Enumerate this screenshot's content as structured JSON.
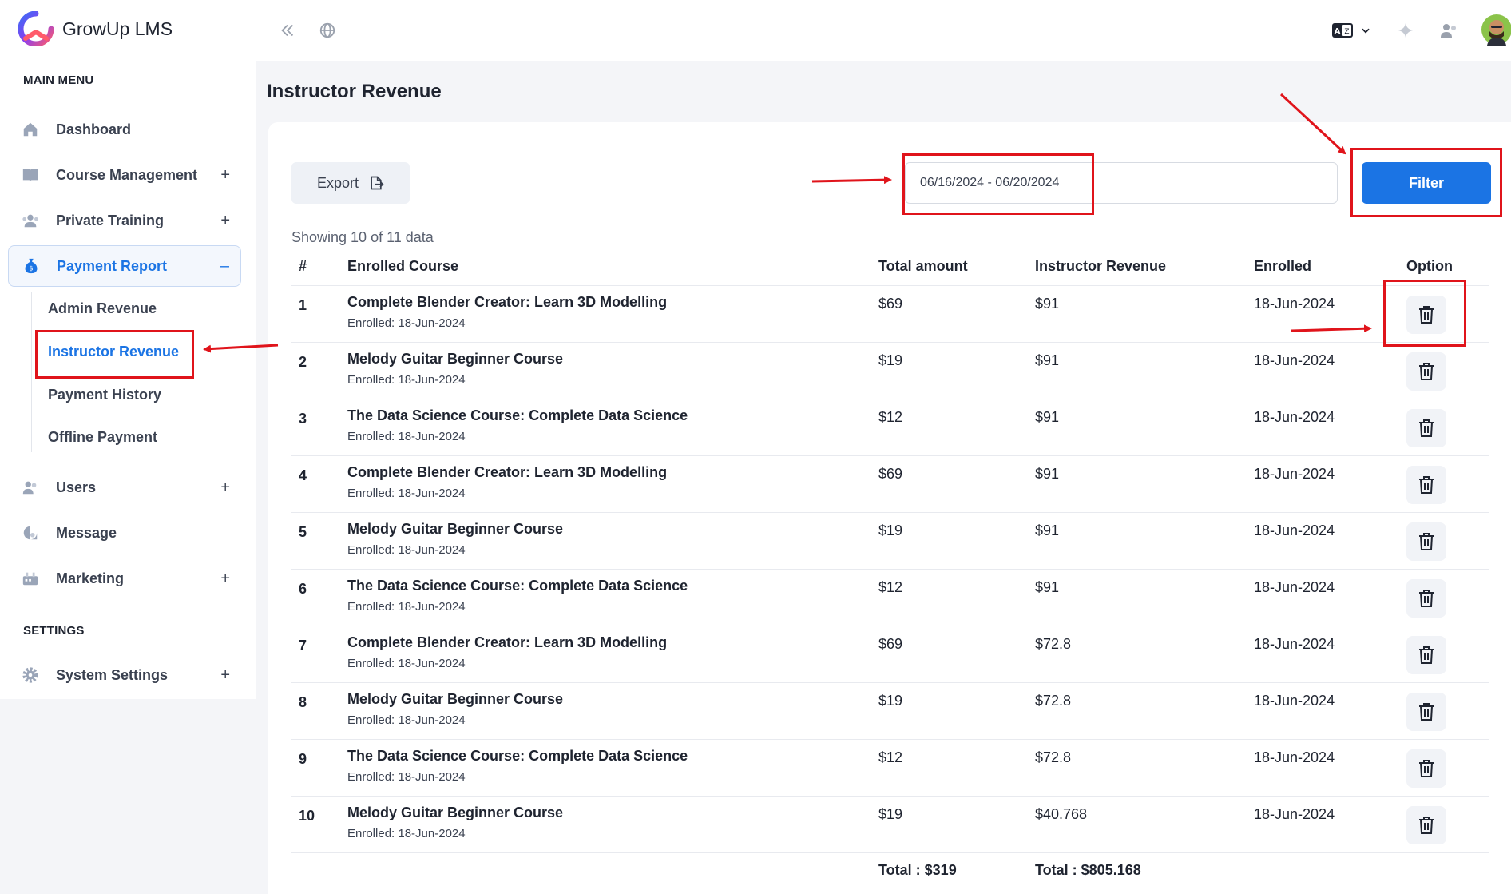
{
  "app": {
    "name": "GrowUp LMS"
  },
  "sidebar": {
    "main_menu_label": "MAIN MENU",
    "settings_label": "SETTINGS",
    "items": [
      {
        "label": "Dashboard",
        "icon": "home-icon"
      },
      {
        "label": "Course Management",
        "icon": "book-icon",
        "toggle": "+"
      },
      {
        "label": "Private Training",
        "icon": "users-icon",
        "toggle": "+"
      },
      {
        "label": "Payment Report",
        "icon": "money-bag-icon",
        "toggle": "–"
      },
      {
        "label": "Users",
        "icon": "user-icon",
        "toggle": "+"
      },
      {
        "label": "Message",
        "icon": "message-icon"
      },
      {
        "label": "Marketing",
        "icon": "megaphone-icon",
        "toggle": "+"
      },
      {
        "label": "System Settings",
        "icon": "gear-icon",
        "toggle": "+"
      }
    ],
    "payment_sub": [
      "Admin Revenue",
      "Instructor Revenue",
      "Payment History",
      "Offline Payment"
    ]
  },
  "page": {
    "title": "Instructor Revenue",
    "export_label": "Export",
    "date_range": "06/16/2024 - 06/20/2024",
    "filter_label": "Filter",
    "showing": "Showing 10 of 11 data"
  },
  "table": {
    "headers": [
      "#",
      "Enrolled Course",
      "Total amount",
      "Instructor Revenue",
      "Enrolled",
      "Option"
    ],
    "rows": [
      {
        "num": "1",
        "course": "Complete Blender Creator: Learn 3D Modelling",
        "enrolled_sub": "Enrolled: 18-Jun-2024",
        "amount": "$69",
        "revenue": "$91",
        "date": "18-Jun-2024"
      },
      {
        "num": "2",
        "course": "Melody Guitar Beginner Course",
        "enrolled_sub": "Enrolled: 18-Jun-2024",
        "amount": "$19",
        "revenue": "$91",
        "date": "18-Jun-2024"
      },
      {
        "num": "3",
        "course": "The Data Science Course: Complete Data Science",
        "enrolled_sub": "Enrolled: 18-Jun-2024",
        "amount": "$12",
        "revenue": "$91",
        "date": "18-Jun-2024"
      },
      {
        "num": "4",
        "course": "Complete Blender Creator: Learn 3D Modelling",
        "enrolled_sub": "Enrolled: 18-Jun-2024",
        "amount": "$69",
        "revenue": "$91",
        "date": "18-Jun-2024"
      },
      {
        "num": "5",
        "course": "Melody Guitar Beginner Course",
        "enrolled_sub": "Enrolled: 18-Jun-2024",
        "amount": "$19",
        "revenue": "$91",
        "date": "18-Jun-2024"
      },
      {
        "num": "6",
        "course": "The Data Science Course: Complete Data Science",
        "enrolled_sub": "Enrolled: 18-Jun-2024",
        "amount": "$12",
        "revenue": "$91",
        "date": "18-Jun-2024"
      },
      {
        "num": "7",
        "course": "Complete Blender Creator: Learn 3D Modelling",
        "enrolled_sub": "Enrolled: 18-Jun-2024",
        "amount": "$69",
        "revenue": "$72.8",
        "date": "18-Jun-2024"
      },
      {
        "num": "8",
        "course": "Melody Guitar Beginner Course",
        "enrolled_sub": "Enrolled: 18-Jun-2024",
        "amount": "$19",
        "revenue": "$72.8",
        "date": "18-Jun-2024"
      },
      {
        "num": "9",
        "course": "The Data Science Course: Complete Data Science",
        "enrolled_sub": "Enrolled: 18-Jun-2024",
        "amount": "$12",
        "revenue": "$72.8",
        "date": "18-Jun-2024"
      },
      {
        "num": "10",
        "course": "Melody Guitar Beginner Course",
        "enrolled_sub": "Enrolled: 18-Jun-2024",
        "amount": "$19",
        "revenue": "$40.768",
        "date": "18-Jun-2024"
      }
    ],
    "total_amount": "Total : $319",
    "total_revenue": "Total : $805.168"
  },
  "colors": {
    "accent": "#1b74e4",
    "annotation": "#e0141b"
  }
}
